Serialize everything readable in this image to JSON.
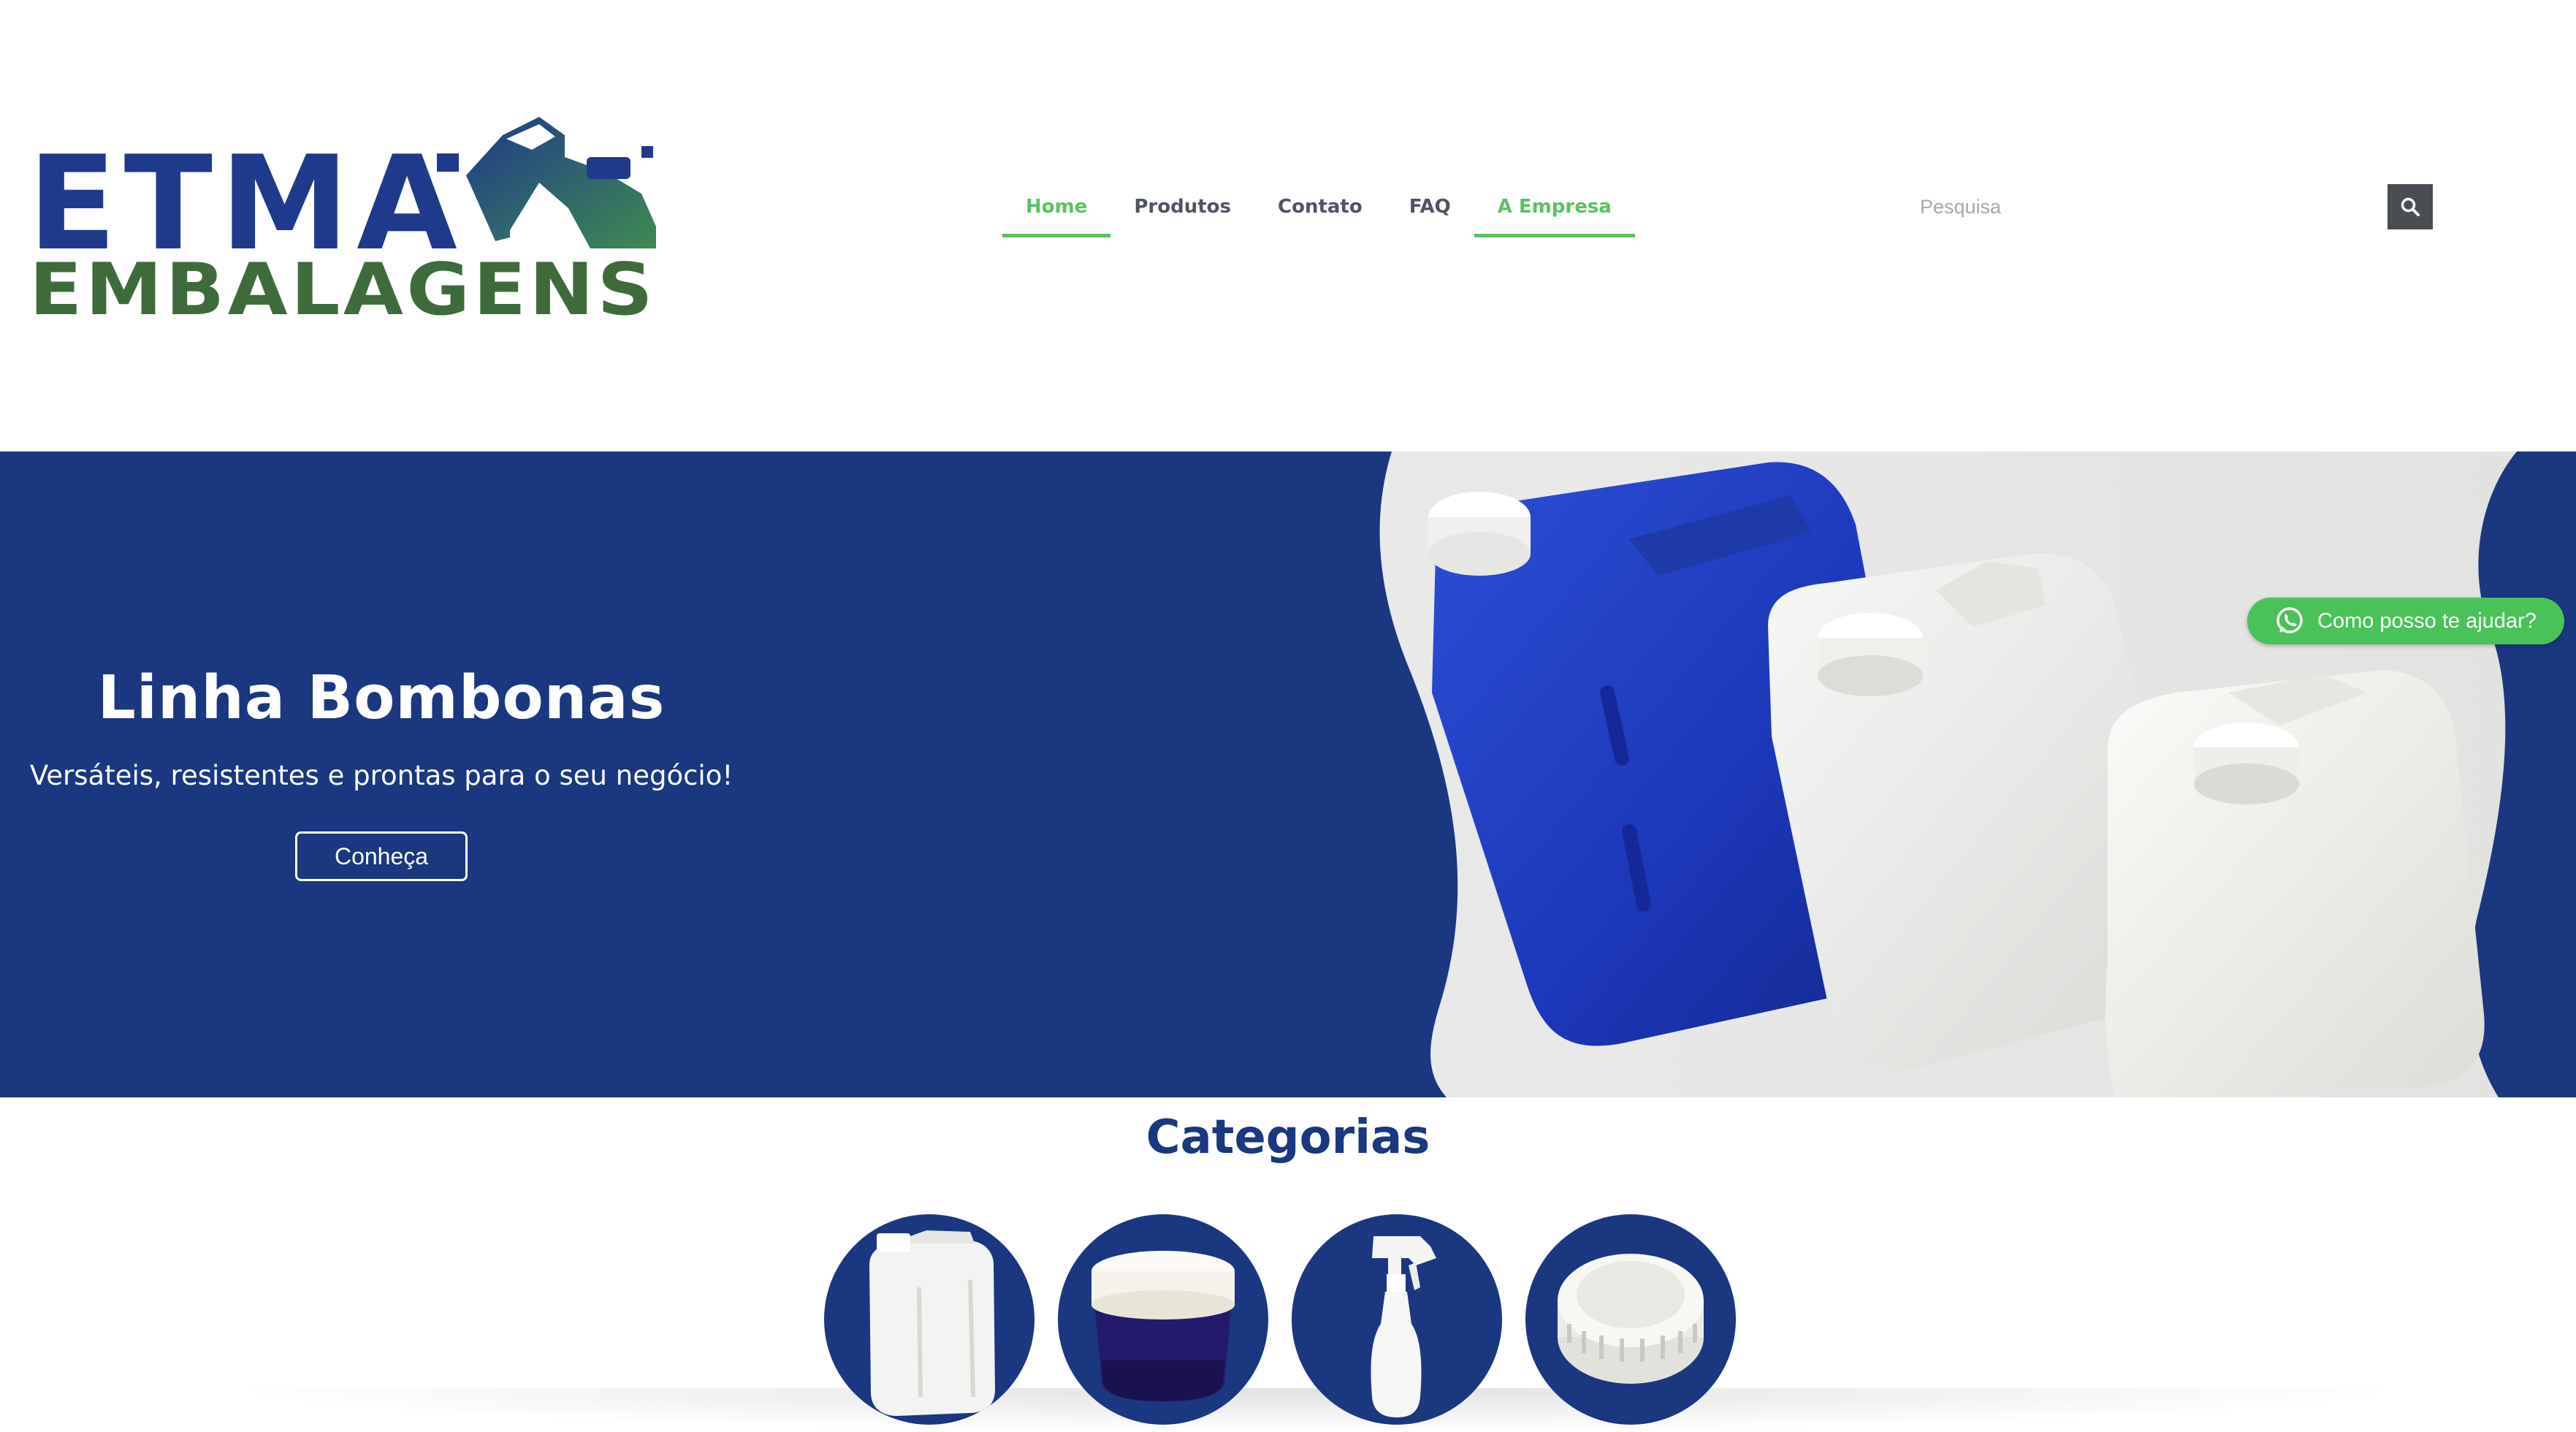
{
  "header": {
    "logo": {
      "line1": "ETMA",
      "line2": "EMBALAGENS",
      "colors": {
        "blue": "#1f3a8a",
        "green": "#3f6b3c"
      }
    },
    "nav": [
      {
        "label": "Home",
        "active": true
      },
      {
        "label": "Produtos",
        "active": false
      },
      {
        "label": "Contato",
        "active": false
      },
      {
        "label": "FAQ",
        "active": false
      },
      {
        "label": "A Empresa",
        "active": true
      }
    ],
    "search": {
      "placeholder": "Pesquisa",
      "value": "",
      "button_icon": "search-icon"
    }
  },
  "hero": {
    "title": "Linha Bombonas",
    "subtitle": "Versáteis, resistentes e prontas para o seu negócio!",
    "button_label": "Conheça",
    "background_color": "#1a3780"
  },
  "whatsapp": {
    "label": "Como posso te ajudar?",
    "icon": "whatsapp-icon",
    "color": "#4ac25a"
  },
  "categories": {
    "title": "Categorias",
    "items": [
      {
        "icon": "jerrycan-image"
      },
      {
        "icon": "pot-image"
      },
      {
        "icon": "spray-bottle-image"
      },
      {
        "icon": "cap-image"
      }
    ]
  },
  "colors": {
    "brand_blue": "#1a3780",
    "accent_green": "#5fbf66",
    "nav_text": "#4f5560"
  }
}
